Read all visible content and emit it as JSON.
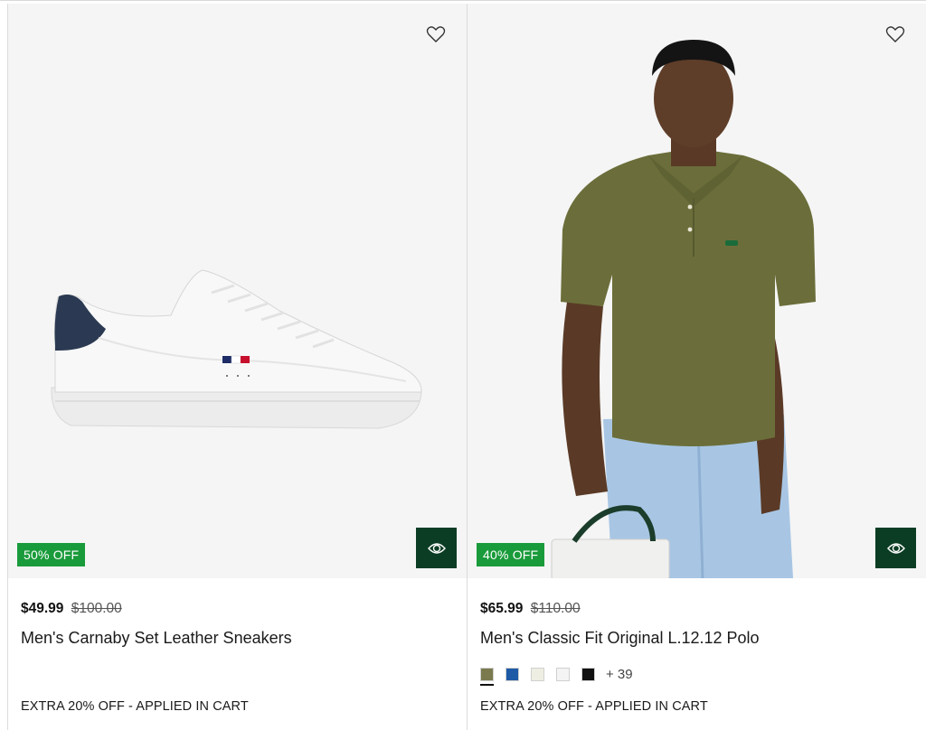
{
  "products": [
    {
      "badge": "50% OFF",
      "price": "$49.99",
      "old_price": "$100.00",
      "title": "Men's Carnaby Set Leather Sneakers",
      "promo": "EXTRA 20% OFF - APPLIED IN CART"
    },
    {
      "badge": "40% OFF",
      "price": "$65.99",
      "old_price": "$110.00",
      "title": "Men's Classic Fit Original L.12.12 Polo",
      "promo": "EXTRA 20% OFF - APPLIED IN CART",
      "swatches": [
        "#7a7a4e",
        "#1f5aa6",
        "#efeee3",
        "#f4f4f4",
        "#111111"
      ],
      "more_colors": "+ 39"
    }
  ],
  "colors": {
    "badge_green": "#1a9b3b",
    "quickview_green": "#0b3d24",
    "card_bg": "#f5f5f5"
  },
  "icons": {
    "wishlist": "heart-outline-icon",
    "quickview": "eye-icon"
  }
}
